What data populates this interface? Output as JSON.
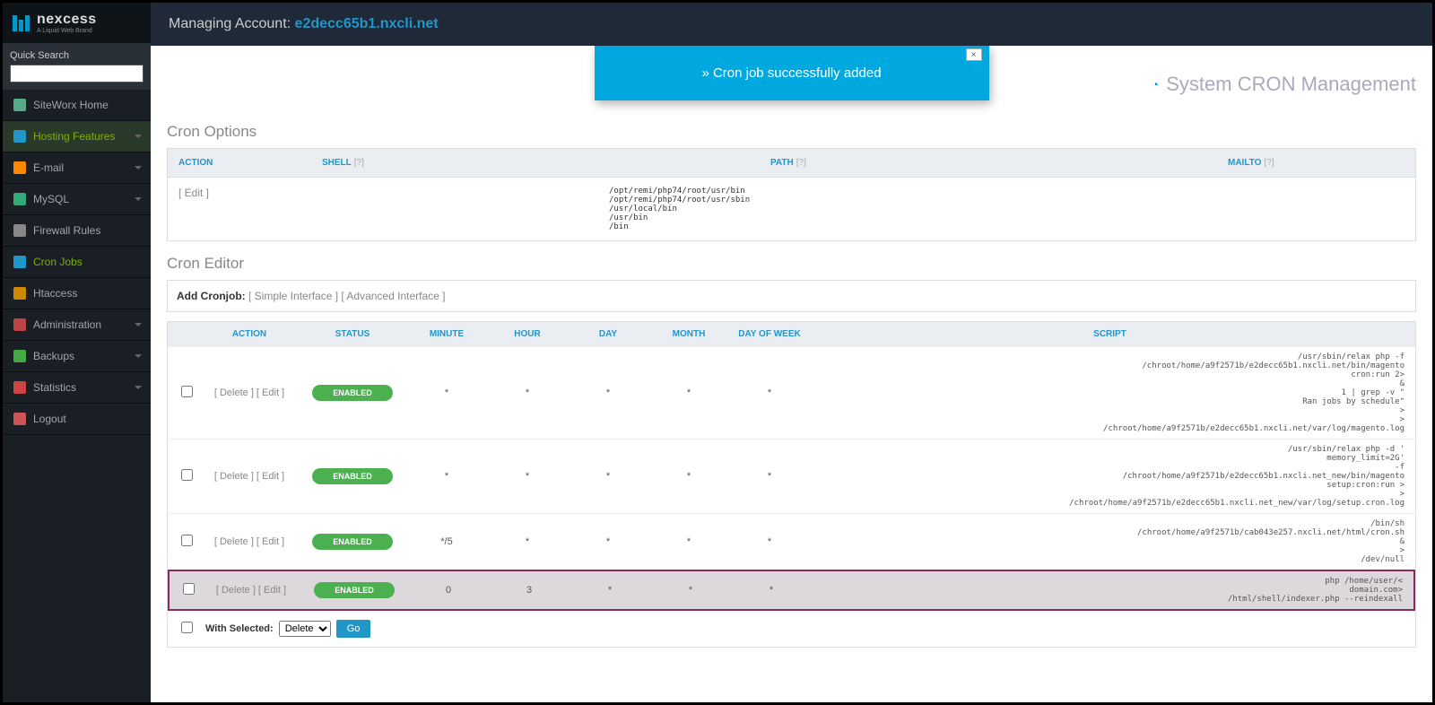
{
  "logo": {
    "name": "nexcess",
    "subtitle": "A Liquid Web Brand"
  },
  "quickSearch": {
    "label": "Quick Search",
    "value": ""
  },
  "sidebar": [
    {
      "label": "SiteWorx Home",
      "iconColor": "#5a8"
    },
    {
      "label": "Hosting Features",
      "iconColor": "#2196c9",
      "active": true,
      "expandable": true
    },
    {
      "label": "E-mail",
      "iconColor": "#f80",
      "expandable": true
    },
    {
      "label": "MySQL",
      "iconColor": "#3a7",
      "expandable": true
    },
    {
      "label": "Firewall Rules",
      "iconColor": "#888"
    },
    {
      "label": "Cron Jobs",
      "iconColor": "#2196c9",
      "activeSub": true
    },
    {
      "label": "Htaccess",
      "iconColor": "#c80"
    },
    {
      "label": "Administration",
      "iconColor": "#b44",
      "expandable": true
    },
    {
      "label": "Backups",
      "iconColor": "#4a4",
      "expandable": true
    },
    {
      "label": "Statistics",
      "iconColor": "#c44",
      "expandable": true
    },
    {
      "label": "Logout",
      "iconColor": "#c55"
    }
  ],
  "header": {
    "prefix": "Managing Account: ",
    "account": "e2decc65b1.nxcli.net"
  },
  "notification": {
    "text": "» Cron job successfully added",
    "close": "×"
  },
  "page": {
    "title": "System CRON Management",
    "icon": "◔"
  },
  "cronOptions": {
    "title": "Cron Options",
    "headers": {
      "action": "ACTION",
      "shell": "SHELL",
      "path": "PATH",
      "mailto": "MAILTO",
      "help": "[?]"
    },
    "edit": "[ Edit ]",
    "shellText": "/opt/remi/php74/root/usr/bin\n/opt/remi/php74/root/usr/sbin\n/usr/local/bin\n/usr/bin\n/bin"
  },
  "cronEditor": {
    "title": "Cron Editor",
    "addLabel": "Add Cronjob:",
    "simple": "[ Simple Interface ]",
    "advanced": "[ Advanced Interface ]"
  },
  "cronTable": {
    "headers": {
      "action": "ACTION",
      "status": "STATUS",
      "minute": "MINUTE",
      "hour": "HOUR",
      "day": "DAY",
      "month": "MONTH",
      "dow": "DAY OF WEEK",
      "script": "SCRIPT"
    },
    "rows": [
      {
        "actions": "[ Delete ] [ Edit ]",
        "status": "ENABLED",
        "minute": "*",
        "hour": "*",
        "day": "*",
        "month": "*",
        "dow": "*",
        "script": "/usr/sbin/relax php -f\n/chroot/home/a9f2571b/e2decc65b1.nxcli.net/bin/magento\ncron:run 2>\n&\n1 | grep -v \"\nRan jobs by schedule\"\n>\n>\n/chroot/home/a9f2571b/e2decc65b1.nxcli.net/var/log/magento.log"
      },
      {
        "actions": "[ Delete ] [ Edit ]",
        "status": "ENABLED",
        "minute": "*",
        "hour": "*",
        "day": "*",
        "month": "*",
        "dow": "*",
        "script": "/usr/sbin/relax php -d '\nmemory_limit=2G'\n-f\n/chroot/home/a9f2571b/e2decc65b1.nxcli.net_new/bin/magento\nsetup:cron:run >\n>\n/chroot/home/a9f2571b/e2decc65b1.nxcli.net_new/var/log/setup.cron.log"
      },
      {
        "actions": "[ Delete ] [ Edit ]",
        "status": "ENABLED",
        "minute": "*/5",
        "hour": "*",
        "day": "*",
        "month": "*",
        "dow": "*",
        "script": "/bin/sh\n/chroot/home/a9f2571b/cab043e257.nxcli.net/html/cron.sh\n&\n>\n/dev/null"
      },
      {
        "actions": "[ Delete ] [ Edit ]",
        "status": "ENABLED",
        "minute": "0",
        "hour": "3",
        "day": "*",
        "month": "*",
        "dow": "*",
        "script": "php /home/user/<\ndomain.com>\n/html/shell/indexer.php --reindexall",
        "highlighted": true
      }
    ],
    "bulk": {
      "label": "With Selected:",
      "option": "Delete",
      "button": "Go"
    }
  }
}
